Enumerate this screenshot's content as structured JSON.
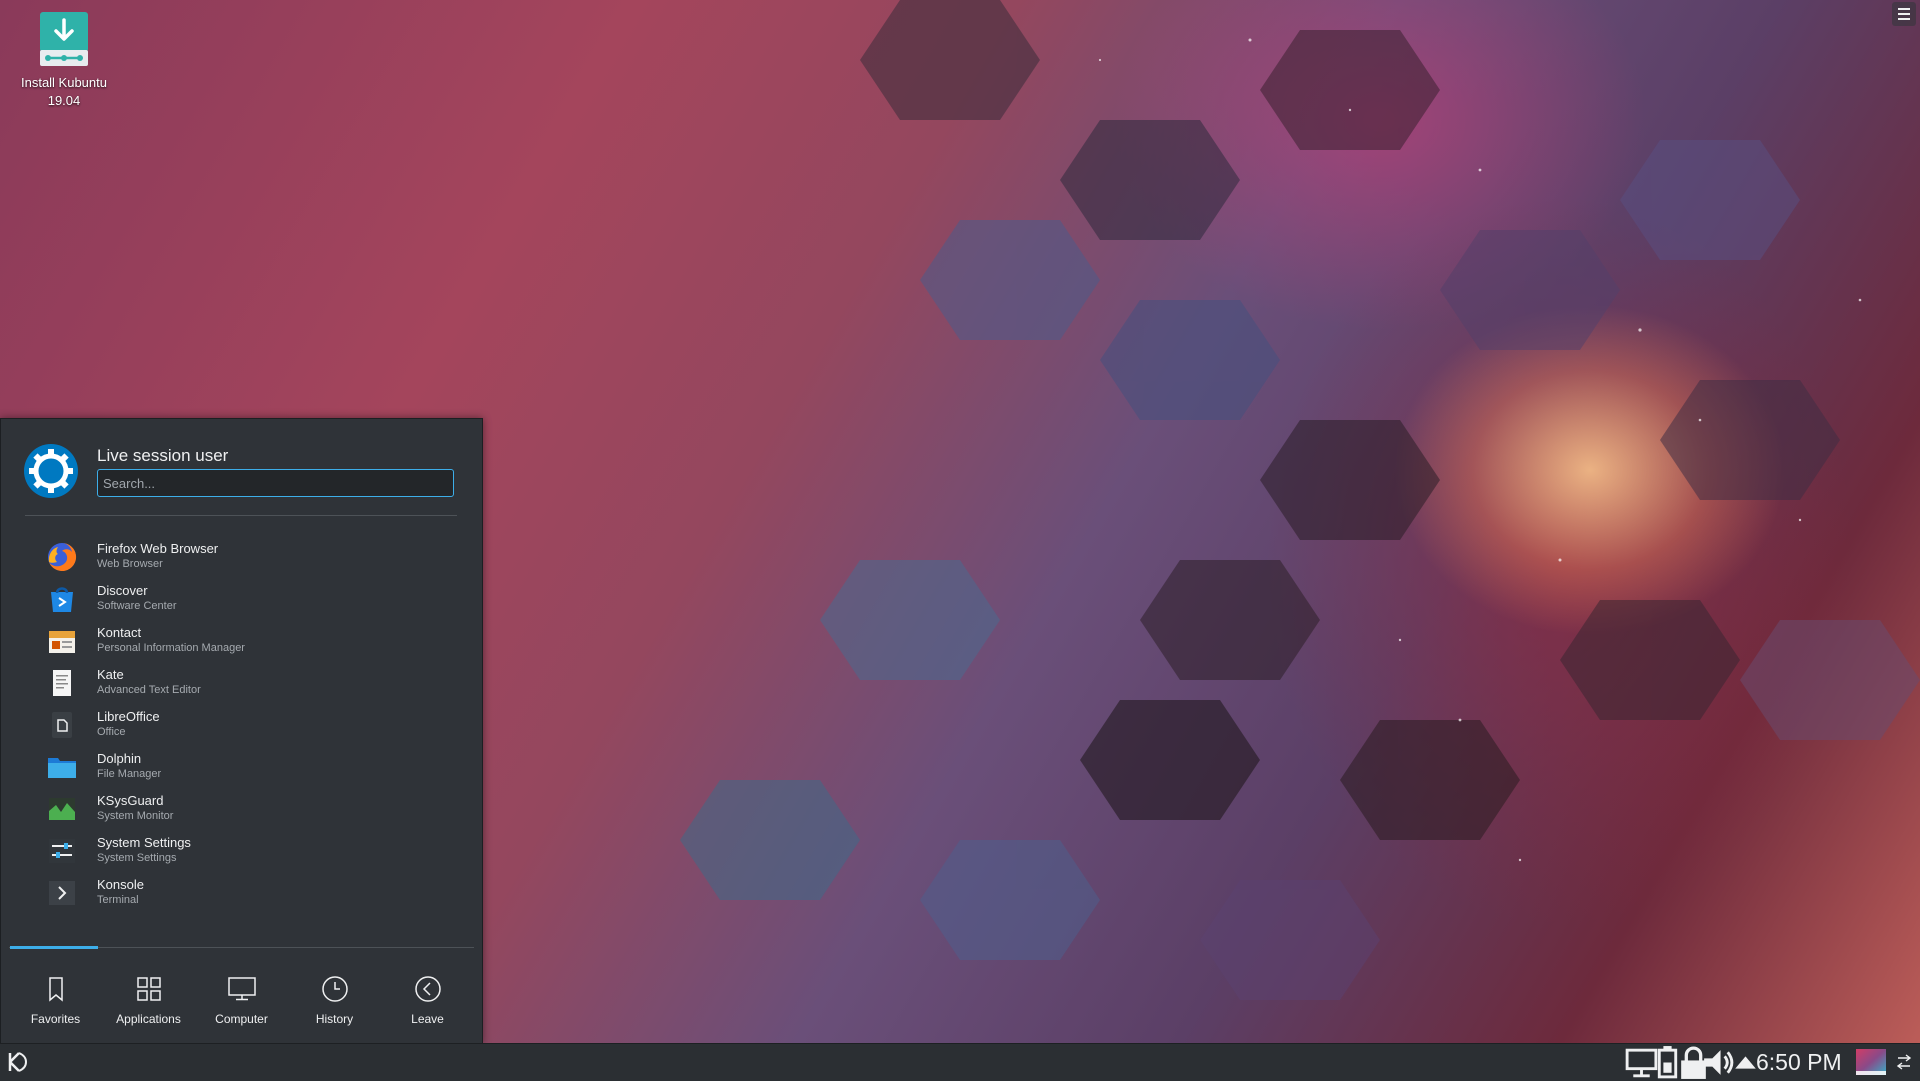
{
  "desktop": {
    "icons": [
      {
        "label_line1": "Install Kubuntu",
        "label_line2": "19.04",
        "icon": "install-download-icon"
      }
    ]
  },
  "launcher": {
    "user_name": "Live session user",
    "search_placeholder": "Search...",
    "favorites": [
      {
        "name": "Firefox Web Browser",
        "desc": "Web Browser",
        "icon": "firefox-icon"
      },
      {
        "name": "Discover",
        "desc": "Software Center",
        "icon": "discover-icon"
      },
      {
        "name": "Kontact",
        "desc": "Personal Information Manager",
        "icon": "kontact-icon"
      },
      {
        "name": "Kate",
        "desc": "Advanced Text Editor",
        "icon": "kate-icon"
      },
      {
        "name": "LibreOffice",
        "desc": "Office",
        "icon": "libreoffice-icon"
      },
      {
        "name": "Dolphin",
        "desc": "File Manager",
        "icon": "folder-icon"
      },
      {
        "name": "KSysGuard",
        "desc": "System Monitor",
        "icon": "system-monitor-icon"
      },
      {
        "name": "System Settings",
        "desc": "System Settings",
        "icon": "settings-icon"
      },
      {
        "name": "Konsole",
        "desc": "Terminal",
        "icon": "terminal-icon"
      }
    ],
    "tabs": [
      {
        "label": "Favorites",
        "icon": "bookmark-icon",
        "active": true
      },
      {
        "label": "Applications",
        "icon": "grid-icon"
      },
      {
        "label": "Computer",
        "icon": "monitor-icon"
      },
      {
        "label": "History",
        "icon": "clock-icon"
      },
      {
        "label": "Leave",
        "icon": "arrow-left-circle-icon"
      }
    ],
    "accent_color": "#3daee9"
  },
  "panel": {
    "clock": "6:50 PM",
    "tray_icons": [
      "display-icon",
      "battery-icon",
      "lock-icon",
      "volume-icon",
      "expand-arrow-icon"
    ]
  }
}
